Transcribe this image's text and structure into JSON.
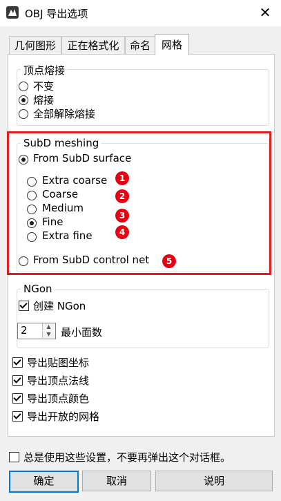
{
  "window": {
    "title": "OBJ 导出选项",
    "close_glyph": "✕"
  },
  "tabs": [
    {
      "label": "几何图形",
      "active": false
    },
    {
      "label": "正在格式化",
      "active": false
    },
    {
      "label": "命名",
      "active": false
    },
    {
      "label": "网格",
      "active": true
    }
  ],
  "vertex_weld": {
    "legend": "顶点熔接",
    "options": [
      {
        "label": "不变",
        "checked": false
      },
      {
        "label": "熔接",
        "checked": true
      },
      {
        "label": "全部解除熔接",
        "checked": false
      }
    ]
  },
  "subd_meshing": {
    "legend": "SubD meshing",
    "from_surface": {
      "label": "From SubD surface",
      "checked": true
    },
    "density_options": [
      {
        "label": "Extra coarse",
        "checked": false
      },
      {
        "label": "Coarse",
        "checked": false
      },
      {
        "label": "Medium",
        "checked": false
      },
      {
        "label": "Fine",
        "checked": true
      },
      {
        "label": "Extra fine",
        "checked": false
      }
    ],
    "from_control_net": {
      "label": "From SubD control net",
      "checked": false
    }
  },
  "annotations": {
    "badges": [
      "1",
      "2",
      "3",
      "4",
      "5"
    ],
    "highlight_color": "#e02020"
  },
  "ngon": {
    "legend": "NGon",
    "create": {
      "label": "创建 NGon",
      "checked": true
    },
    "min_faces": {
      "value": "2",
      "label": "最小面数"
    }
  },
  "export_options": [
    {
      "label": "导出贴图坐标",
      "checked": true
    },
    {
      "label": "导出顶点法线",
      "checked": true
    },
    {
      "label": "导出顶点颜色",
      "checked": true
    },
    {
      "label": "导出开放的网格",
      "checked": true
    }
  ],
  "always_use": {
    "label": "总是使用这些设置，不要再弹出这个对话框。",
    "checked": false
  },
  "buttons": {
    "ok": "确定",
    "cancel": "取消",
    "help": "说明"
  },
  "colors": {
    "accent": "#0078d7",
    "badge": "#e60012"
  }
}
